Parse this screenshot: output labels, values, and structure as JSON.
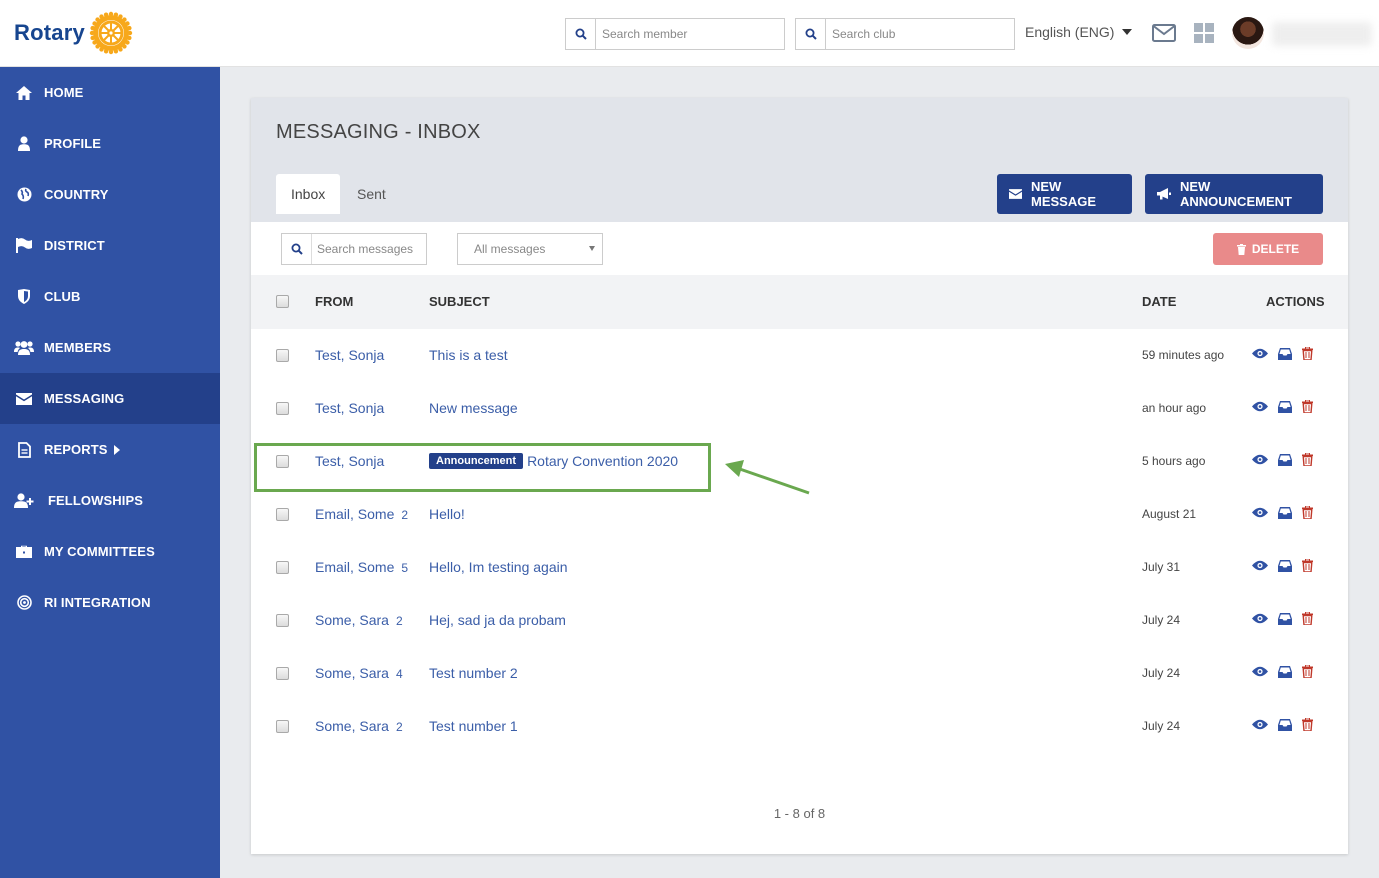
{
  "header": {
    "logo_text": "Rotary",
    "search_member_placeholder": "Search member",
    "search_club_placeholder": "Search club",
    "language": "English (ENG)"
  },
  "sidebar": {
    "items": [
      {
        "label": "HOME",
        "icon": "home-icon"
      },
      {
        "label": "PROFILE",
        "icon": "user-icon"
      },
      {
        "label": "COUNTRY",
        "icon": "globe-icon"
      },
      {
        "label": "DISTRICT",
        "icon": "flag-icon"
      },
      {
        "label": "CLUB",
        "icon": "shield-icon"
      },
      {
        "label": "MEMBERS",
        "icon": "users-icon"
      },
      {
        "label": "MESSAGING",
        "icon": "envelope-icon",
        "active": true
      },
      {
        "label": "REPORTS",
        "icon": "document-icon"
      },
      {
        "label": "FELLOWSHIPS",
        "icon": "user-plus-icon"
      },
      {
        "label": "MY COMMITTEES",
        "icon": "briefcase-icon"
      },
      {
        "label": "RI INTEGRATION",
        "icon": "target-icon"
      }
    ]
  },
  "panel": {
    "title": "MESSAGING - INBOX",
    "tabs": [
      {
        "label": "Inbox",
        "active": true
      },
      {
        "label": "Sent",
        "active": false
      }
    ],
    "new_message_label": "NEW MESSAGE",
    "new_announcement_label": "NEW ANNOUNCEMENT",
    "search_placeholder": "Search messages",
    "filter_value": "All messages",
    "delete_label": "DELETE"
  },
  "table": {
    "columns": {
      "from": "FROM",
      "subject": "SUBJECT",
      "date": "DATE",
      "actions": "ACTIONS"
    },
    "rows": [
      {
        "from": "Test, Sonja",
        "count": "",
        "badge": "",
        "subject": "This is a test",
        "date": "59 minutes ago"
      },
      {
        "from": "Test, Sonja",
        "count": "",
        "badge": "",
        "subject": "New message",
        "date": "an hour ago"
      },
      {
        "from": "Test, Sonja",
        "count": "",
        "badge": "Announcement",
        "subject": "Rotary Convention 2020",
        "date": "5 hours ago"
      },
      {
        "from": "Email, Some",
        "count": "2",
        "badge": "",
        "subject": "Hello!",
        "date": "August 21"
      },
      {
        "from": "Email, Some",
        "count": "5",
        "badge": "",
        "subject": "Hello, Im testing again",
        "date": "July 31"
      },
      {
        "from": "Some, Sara",
        "count": "2",
        "badge": "",
        "subject": "Hej, sad ja da probam",
        "date": "July 24"
      },
      {
        "from": "Some, Sara",
        "count": "4",
        "badge": "",
        "subject": "Test number 2",
        "date": "July 24"
      },
      {
        "from": "Some, Sara",
        "count": "2",
        "badge": "",
        "subject": "Test number 1",
        "date": "July 24"
      }
    ]
  },
  "pagination": "1 - 8 of 8",
  "colors": {
    "sidebar": "#3052a4",
    "sidebar_active": "#23408a",
    "primary": "#23408a",
    "link": "#3b5ea8",
    "delete": "#e98a8a",
    "highlight": "#6aa84f"
  }
}
